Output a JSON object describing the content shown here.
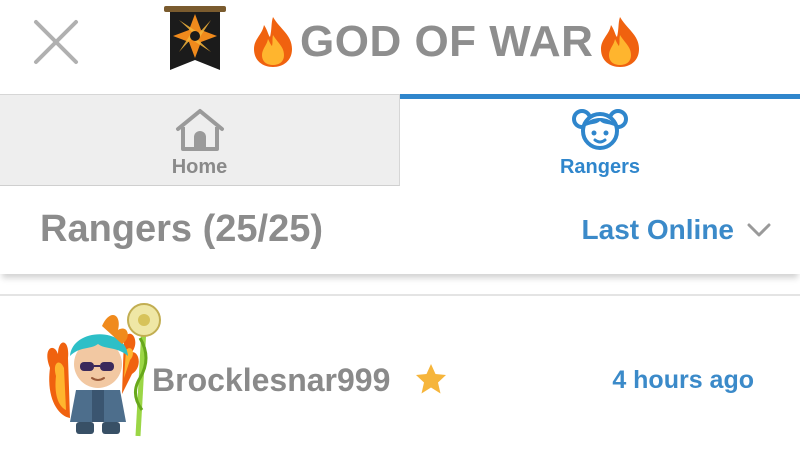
{
  "header": {
    "close_icon": "close-icon",
    "title": "GOD OF WAR",
    "banner_icon": "guild-banner-icon",
    "flame_icon": "fire-emoji-icon"
  },
  "tabs": [
    {
      "label": "Home",
      "icon": "home-icon",
      "active": false
    },
    {
      "label": "Rangers",
      "icon": "rangers-icon",
      "active": true
    }
  ],
  "section": {
    "title": "Rangers (25/25)",
    "sort_label": "Last Online"
  },
  "members": [
    {
      "name": "Brocklesnar999",
      "last_online": "4 hours ago",
      "badge": "star-icon"
    }
  ],
  "colors": {
    "accent": "#2f86cc",
    "text_gray": "#8c8c8c",
    "tab_inactive_bg": "#eeeeee",
    "star": "#f6b53b"
  }
}
